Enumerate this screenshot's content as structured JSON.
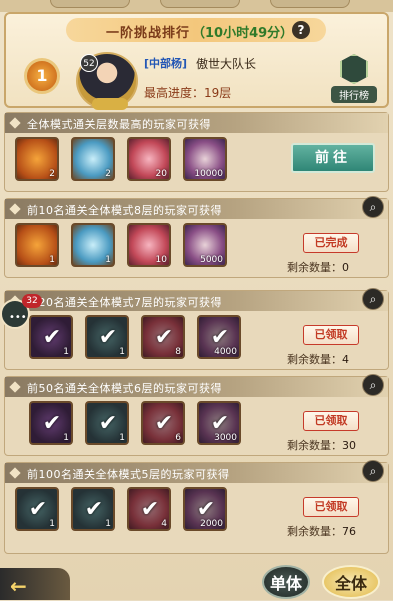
{
  "header": {
    "title": "一阶挑战排行",
    "timer": "（10小时49分）",
    "help": "?",
    "rank_badge": "1",
    "avatar_level": "52",
    "guild": "[中部杨]",
    "player_name": "傲世大队长",
    "progress": "最高进度：19层",
    "leaderboard_label": "排行榜"
  },
  "sections": [
    {
      "title": "全体模式通关层数最高的玩家可获得",
      "button": "前往",
      "items": [
        {
          "count": "2"
        },
        {
          "count": "2"
        },
        {
          "count": "20"
        },
        {
          "count": "10000"
        }
      ]
    },
    {
      "title": "前10名通关全体模式8层的玩家可获得",
      "status": "已完成",
      "remain_label": "剩余数量：",
      "remain_value": "0",
      "items": [
        {
          "count": "1"
        },
        {
          "count": "1"
        },
        {
          "count": "10"
        },
        {
          "count": "5000"
        }
      ]
    },
    {
      "title": "前20名通关全体模式7层的玩家可获得",
      "status": "已领取",
      "remain_label": "剩余数量：",
      "remain_value": "4",
      "items": [
        {
          "count": "1"
        },
        {
          "count": "1"
        },
        {
          "count": "8"
        },
        {
          "count": "4000"
        }
      ]
    },
    {
      "title": "前50名通关全体模式6层的玩家可获得",
      "status": "已领取",
      "remain_label": "剩余数量：",
      "remain_value": "30",
      "items": [
        {
          "count": "1"
        },
        {
          "count": "1"
        },
        {
          "count": "6"
        },
        {
          "count": "3000"
        }
      ]
    },
    {
      "title": "前100名通关全体模式5层的玩家可获得",
      "status": "已领取",
      "remain_label": "剩余数量：",
      "remain_value": "76",
      "items": [
        {
          "count": "1"
        },
        {
          "count": "1"
        },
        {
          "count": "4"
        },
        {
          "count": "2000"
        }
      ]
    }
  ],
  "chat_badge": "32",
  "bottom": {
    "single": "单体",
    "all": "全体"
  }
}
